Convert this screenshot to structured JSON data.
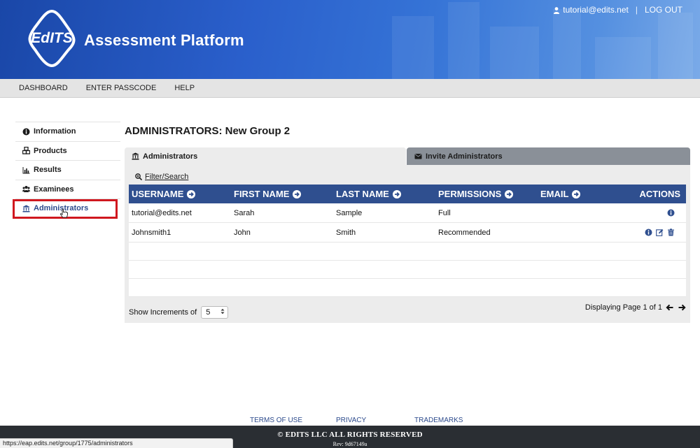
{
  "header": {
    "app_title": "Assessment Platform",
    "logo_text": "EdITS",
    "user_email": "tutorial@edits.net",
    "separator": "|",
    "logout_label": "LOG OUT"
  },
  "topnav": {
    "items": [
      {
        "label": "DASHBOARD"
      },
      {
        "label": "ENTER PASSCODE"
      },
      {
        "label": "HELP"
      }
    ]
  },
  "sidebar": {
    "items": [
      {
        "label": "Information",
        "icon": "info-icon"
      },
      {
        "label": "Products",
        "icon": "cubes-icon"
      },
      {
        "label": "Results",
        "icon": "bar-chart-icon"
      },
      {
        "label": "Examinees",
        "icon": "users-icon"
      },
      {
        "label": "Administrators",
        "icon": "bank-icon",
        "active": true
      }
    ]
  },
  "main": {
    "title": "ADMINISTRATORS: New Group 2",
    "tabs": [
      {
        "label": "Administrators",
        "icon": "bank-icon"
      },
      {
        "label": "Invite Administrators",
        "icon": "envelope-icon"
      }
    ],
    "filter_label": "Filter/Search",
    "table": {
      "headers": [
        "USERNAME",
        "FIRST NAME",
        "LAST NAME",
        "PERMISSIONS",
        "EMAIL",
        "ACTIONS"
      ],
      "rows": [
        {
          "username": "tutorial@edits.net",
          "first": "Sarah",
          "last": "Sample",
          "permissions": "Full",
          "email": ""
        },
        {
          "username": "Johnsmith1",
          "first": "John",
          "last": "Smith",
          "permissions": "Recommended",
          "email": ""
        }
      ]
    },
    "increments_label": "Show Increments of",
    "increments_value": "5",
    "paging_text": "Displaying Page 1 of 1"
  },
  "footer": {
    "links": [
      "TERMS OF USE",
      "PRIVACY",
      "TRADEMARKS"
    ],
    "copyright": "© EDITS LLC ALL RIGHTS RESERVED",
    "revision": "Rev: 9d67149a"
  },
  "statusbar_url": "https://eap.edits.net/group/1775/administrators",
  "colors": {
    "header_start": "#1a47a8",
    "table_header": "#2f4f8f",
    "highlight": "#d0181f",
    "footer": "#2a2e33",
    "active_link": "#2c4a8c"
  }
}
